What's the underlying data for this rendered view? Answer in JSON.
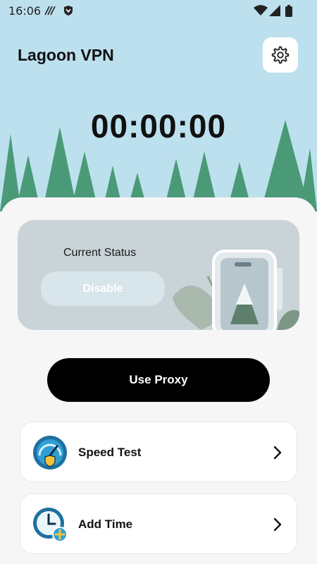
{
  "status_bar": {
    "time": "16:06"
  },
  "header": {
    "title": "Lagoon VPN"
  },
  "timer": {
    "value": "00:00:00"
  },
  "status_card": {
    "label": "Current Status",
    "state": "Disable"
  },
  "actions": {
    "proxy_label": "Use Proxy"
  },
  "menu": [
    {
      "label": "Speed Test",
      "icon": "speedometer-shield-icon"
    },
    {
      "label": "Add Time",
      "icon": "clock-plus-icon"
    }
  ]
}
